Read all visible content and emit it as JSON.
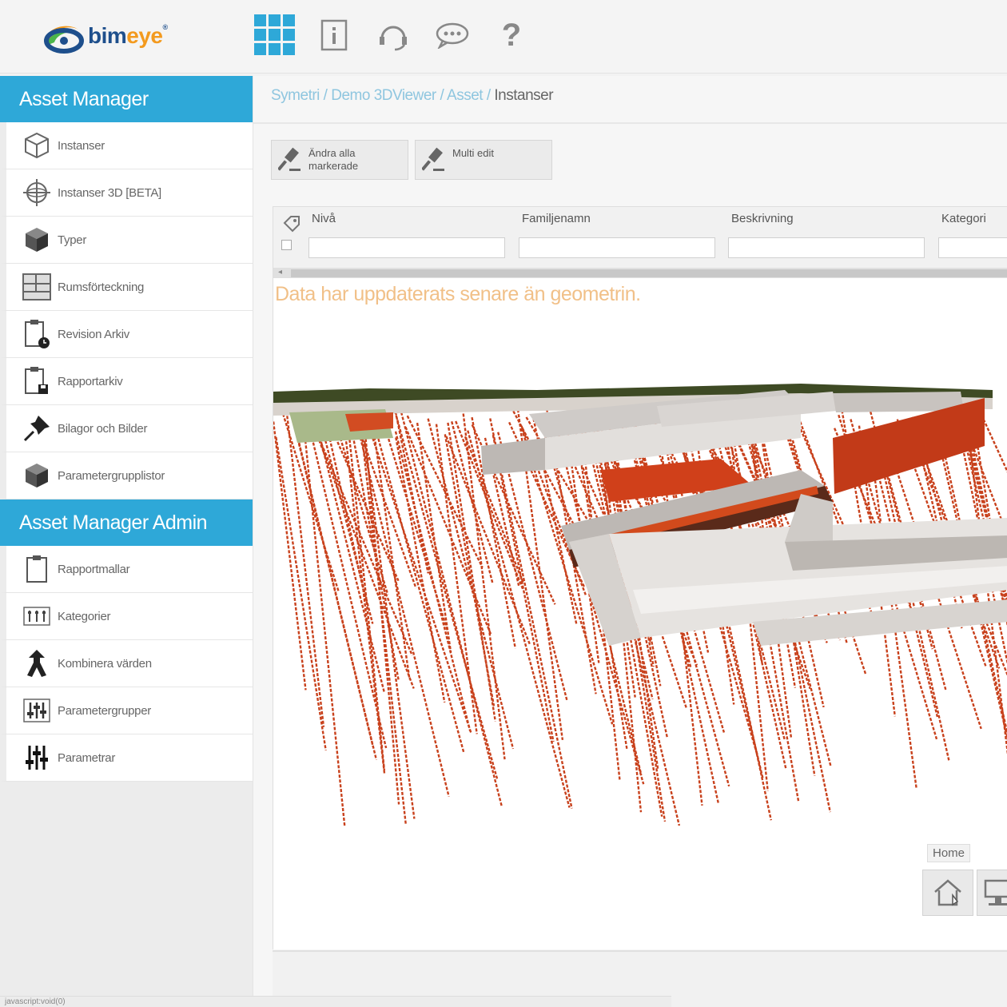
{
  "brand": {
    "name_main": "bim",
    "name_accent": "eye"
  },
  "top_icons": [
    "apps-grid-icon",
    "info-icon",
    "support-headset-icon",
    "chat-icon",
    "help-icon"
  ],
  "help_glyph": "?",
  "sidebar": {
    "section1": {
      "title": "Asset Manager",
      "collapse": "«"
    },
    "items1": [
      {
        "label": "Instanser",
        "icon": "box-outline-icon"
      },
      {
        "label": "Instanser 3D [BETA]",
        "icon": "crosshair-globe-icon"
      },
      {
        "label": "Typer",
        "icon": "box-solid-icon"
      },
      {
        "label": "Rumsförteckning",
        "icon": "floorplan-icon"
      },
      {
        "label": "Revision Arkiv",
        "icon": "clipboard-clock-icon"
      },
      {
        "label": "Rapportarkiv",
        "icon": "clipboard-save-icon"
      },
      {
        "label": "Bilagor och Bilder",
        "icon": "pushpin-icon"
      },
      {
        "label": "Parametergrupplistor",
        "icon": "box-solid-icon"
      }
    ],
    "section2": {
      "title": "Asset Manager Admin"
    },
    "items2": [
      {
        "label": "Rapportmallar",
        "icon": "clipboard-icon"
      },
      {
        "label": "Kategorier",
        "icon": "categories-icon"
      },
      {
        "label": "Kombinera värden",
        "icon": "merge-arrow-icon"
      },
      {
        "label": "Parametergrupper",
        "icon": "sliders-boxed-icon"
      },
      {
        "label": "Parametrar",
        "icon": "sliders-icon"
      }
    ]
  },
  "breadcrumb": {
    "parts": [
      "Symetri",
      "Demo 3DViewer",
      "Asset"
    ],
    "sep": " / ",
    "current": "Instanser"
  },
  "toolbar": {
    "change_all": "Ändra alla\nmarkerade",
    "multi_edit": "Multi edit"
  },
  "grid": {
    "columns": [
      "Nivå",
      "Familjenamn",
      "Beskrivning",
      "Kategori"
    ],
    "scroll_left": "◂"
  },
  "viewer": {
    "warning": "Data har uppdaterats senare än geometrin.",
    "home_label": "Home"
  },
  "status_bar": {
    "text": "javascript:void(0)"
  },
  "colors": {
    "accent": "#2ea8d8",
    "warning": "#f1c088",
    "rebar": "#c8411c"
  }
}
